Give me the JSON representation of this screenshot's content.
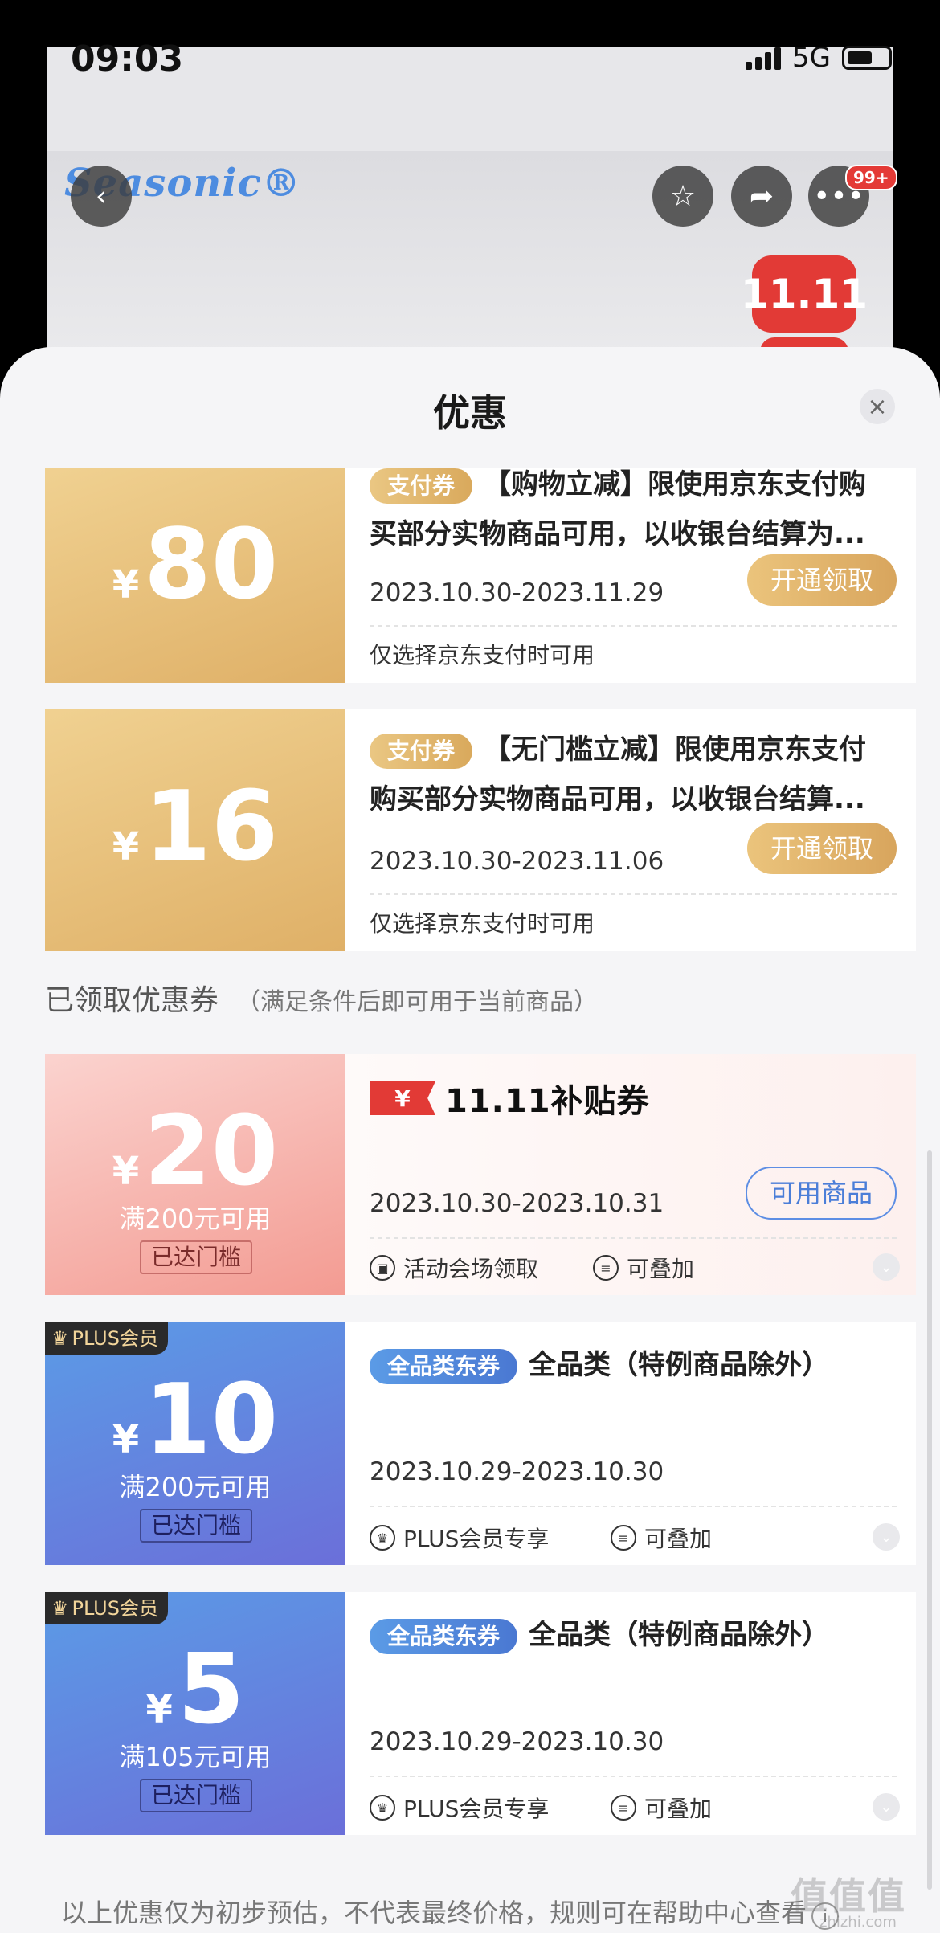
{
  "status_bar": {
    "time": "09:03",
    "network": "5G"
  },
  "page_behind": {
    "brand": "Seasonic®",
    "promo_badge": "11.11",
    "more_badge": "99+"
  },
  "sheet": {
    "title": "优惠",
    "close_icon": "close-icon"
  },
  "available_coupons": [
    {
      "amount_symbol": "¥",
      "amount": "80",
      "tag": "支付券",
      "description": "【购物立减】限使用京东支付购买部分实物商品可用，以收银台结算为…",
      "desc_line1": "【购物立减】限使用京东支付购",
      "desc_line2": "买部分实物商品可用，以收银台结算为...",
      "validity": "2023.10.30-2023.11.29",
      "button": "开通领取",
      "note": "仅选择京东支付时可用"
    },
    {
      "amount_symbol": "¥",
      "amount": "16",
      "tag": "支付券",
      "desc_line1": "【无门槛立减】限使用京东支付",
      "desc_line2": "购买部分实物商品可用，以收银台结算...",
      "validity": "2023.10.30-2023.11.06",
      "button": "开通领取",
      "note": "仅选择京东支付时可用"
    }
  ],
  "claimed_section": {
    "title": "已领取优惠券",
    "subtitle": "（满足条件后即可用于当前商品）"
  },
  "claimed_coupons": [
    {
      "amount_symbol": "¥",
      "amount": "20",
      "condition": "满200元可用",
      "threshold": "已达门槛",
      "title_logo_yen": "¥",
      "title_logo_text": "11.11补贴券",
      "validity": "2023.10.30-2023.10.31",
      "button": "可用商品",
      "feature1": "活动会场领取",
      "feature2": "可叠加"
    },
    {
      "plus_tag": "PLUS会员",
      "amount_symbol": "¥",
      "amount": "10",
      "condition": "满200元可用",
      "threshold": "已达门槛",
      "tag": "全品类东券",
      "title": "全品类（特例商品除外）",
      "validity": "2023.10.29-2023.10.30",
      "feature1": "PLUS会员专享",
      "feature2": "可叠加"
    },
    {
      "plus_tag": "PLUS会员",
      "amount_symbol": "¥",
      "amount": "5",
      "condition": "满105元可用",
      "threshold": "已达门槛",
      "tag": "全品类东券",
      "title": "全品类（特例商品除外）",
      "validity": "2023.10.29-2023.10.30",
      "feature1": "PLUS会员专享",
      "feature2": "可叠加"
    }
  ],
  "footer": {
    "note": "以上优惠仅为初步预估，不代表最终价格，规则可在帮助中心查看",
    "watermark": "值值值",
    "watermark_small": "zhizhi.com"
  },
  "colors": {
    "gold": "#dfb067",
    "pink": "#f39b92",
    "blue": "#6b6fd9",
    "red": "#e23a36"
  }
}
